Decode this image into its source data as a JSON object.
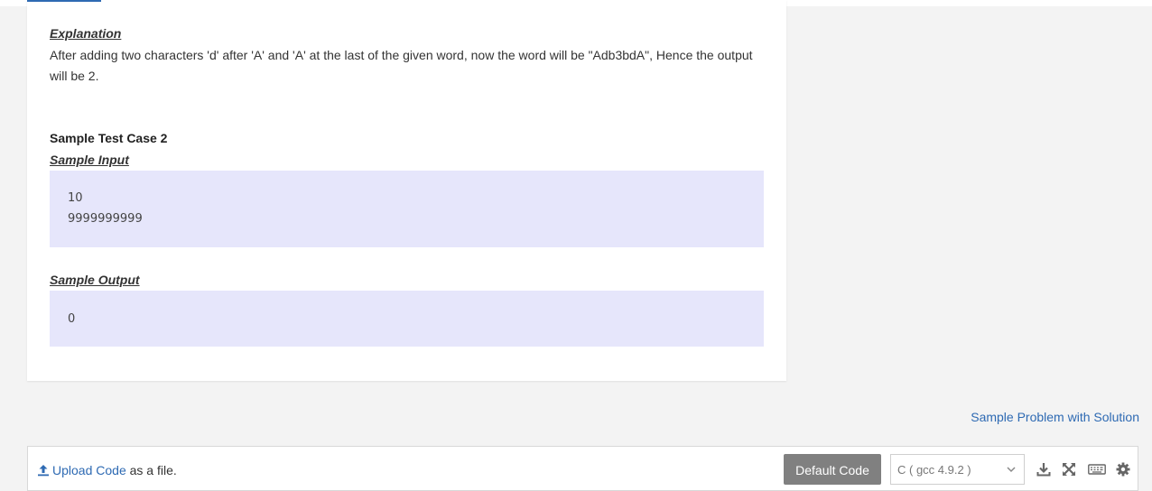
{
  "explanation": {
    "heading": "Explanation",
    "text": "After adding two characters 'd' after 'A' and 'A' at the last of the given word, now the word will be \"Adb3bdA\", Hence the output will be 2."
  },
  "test_case": {
    "title": "Sample Test Case 2",
    "input_label": "Sample Input ",
    "input_lines": [
      "10",
      "9999999999"
    ],
    "output_label": "Sample Output",
    "output_lines": [
      "0"
    ]
  },
  "sample_problem_link": "Sample Problem with Solution",
  "editor_bar": {
    "upload_link": "Upload Code",
    "upload_suffix": " as a file.",
    "default_code_button": "Default Code",
    "language_selected": "C ( gcc 4.9.2 )",
    "icons": [
      "download-icon",
      "fullscreen-icon",
      "keyboard-icon",
      "settings-icon"
    ]
  },
  "colors": {
    "accent": "#2e6ab3",
    "code_bg": "#e6e6fb",
    "button_bg": "#808080"
  }
}
